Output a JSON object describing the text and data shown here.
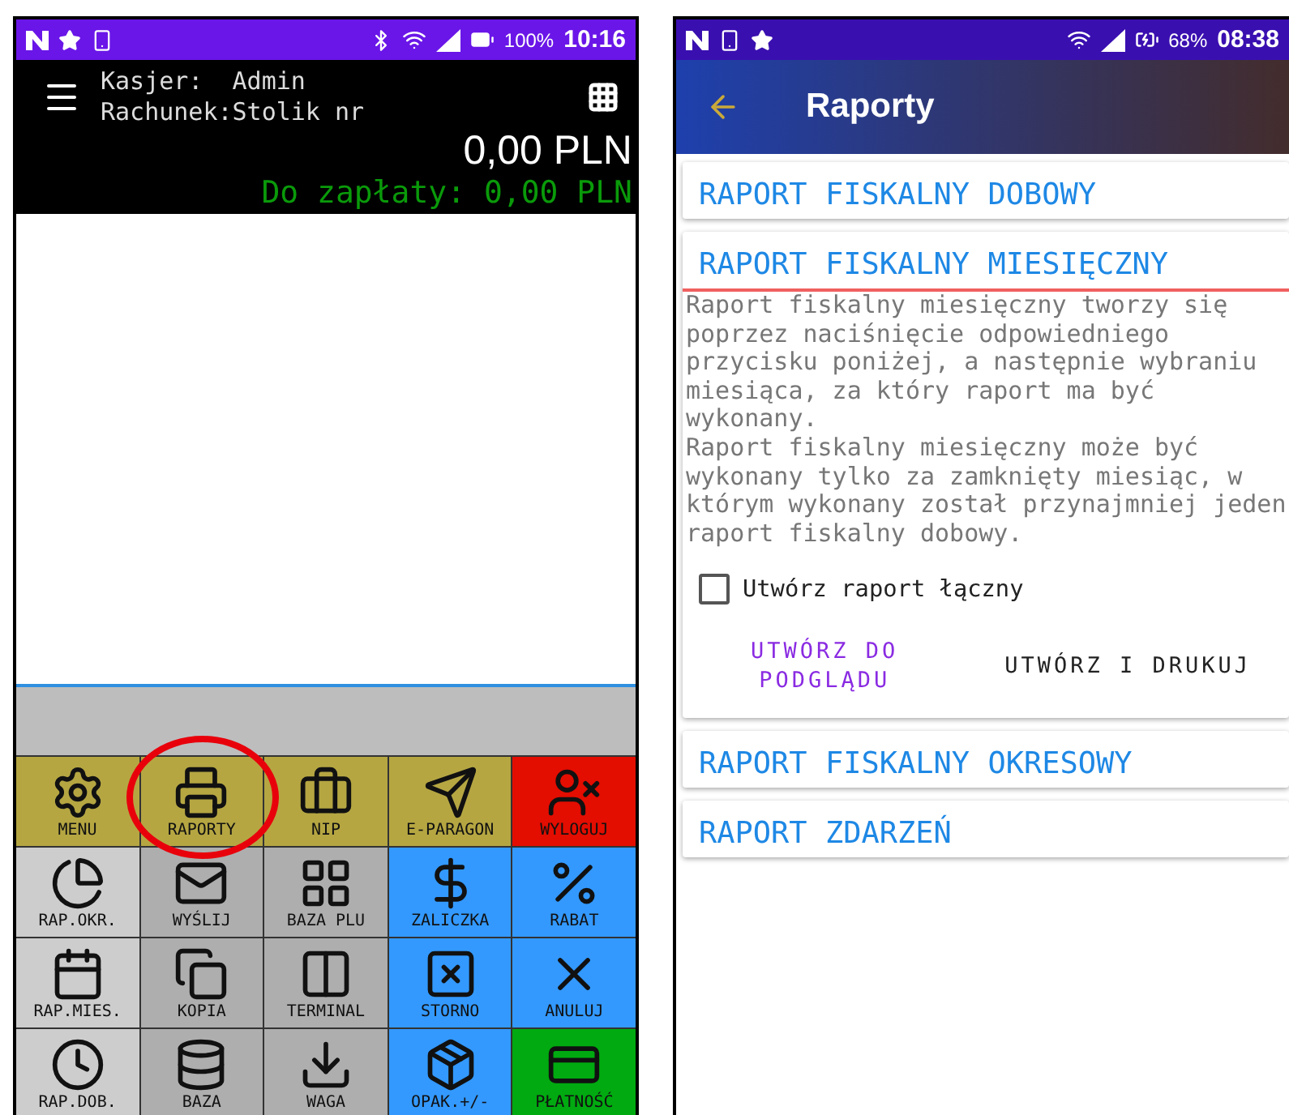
{
  "left_phone": {
    "status_bar": {
      "battery": "100%",
      "time": "10:16"
    },
    "header": {
      "cashier": "Kasjer:  Admin",
      "bill": "Rachunek:Stolik nr",
      "total": "0,00 PLN",
      "to_pay": "Do zapłaty: 0,00 PLN"
    },
    "tiles": [
      {
        "label": "MENU",
        "color": "#b5a642",
        "highlighted": false
      },
      {
        "label": "RAPORTY",
        "color": "#b5a642",
        "highlighted": true
      },
      {
        "label": "NIP",
        "color": "#b5a642",
        "highlighted": false
      },
      {
        "label": "E-PARAGON",
        "color": "#b5a642",
        "highlighted": false
      },
      {
        "label": "WYLOGUJ",
        "color": "#e30d00",
        "highlighted": false
      },
      {
        "label": "RAP.OKR.",
        "color": "#cdcdcd",
        "highlighted": false
      },
      {
        "label": "WYŚLIJ",
        "color": "#aeaeae",
        "highlighted": false
      },
      {
        "label": "BAZA PLU",
        "color": "#aeaeae",
        "highlighted": false
      },
      {
        "label": "ZALICZKA",
        "color": "#3399ff",
        "highlighted": false
      },
      {
        "label": "RABAT",
        "color": "#3399ff",
        "highlighted": false
      },
      {
        "label": "RAP.MIES.",
        "color": "#cdcdcd",
        "highlighted": false
      },
      {
        "label": "KOPIA",
        "color": "#aeaeae",
        "highlighted": false
      },
      {
        "label": "TERMINAL",
        "color": "#aeaeae",
        "highlighted": false
      },
      {
        "label": "STORNO",
        "color": "#3399ff",
        "highlighted": false
      },
      {
        "label": "ANULUJ",
        "color": "#3399ff",
        "highlighted": false
      },
      {
        "label": "RAP.DOB.",
        "color": "#cdcdcd",
        "highlighted": false
      },
      {
        "label": "BAZA",
        "color": "#aeaeae",
        "highlighted": false
      },
      {
        "label": "WAGA",
        "color": "#aeaeae",
        "highlighted": false
      },
      {
        "label": "OPAK.+/-",
        "color": "#3399ff",
        "highlighted": false
      },
      {
        "label": "PŁATNOŚĆ",
        "color": "#00aa10",
        "highlighted": false
      }
    ]
  },
  "right_phone": {
    "status_bar": {
      "battery": "68%",
      "time": "08:38"
    },
    "app_bar": {
      "title": "Raporty"
    },
    "reports": [
      {
        "title": "RAPORT FISKALNY DOBOWY",
        "expanded": false
      },
      {
        "title": "RAPORT FISKALNY MIESIĘCZNY",
        "expanded": true,
        "description": [
          "Raport fiskalny miesięczny tworzy się poprzez naciśnięcie odpowiedniego przycisku poniżej, a następnie wybraniu miesiąca, za który raport ma być wykonany.",
          "Raport fiskalny miesięczny może być wykonany tylko za zamknięty miesiąc, w którym wykonany został przynajmniej jeden raport fiskalny dobowy."
        ],
        "checkbox": {
          "label": "Utwórz raport łączny",
          "checked": false
        },
        "buttons": [
          "UTWÓRZ DO PODGLĄDU",
          "UTWÓRZ I DRUKUJ"
        ]
      },
      {
        "title": "RAPORT FISKALNY OKRESOWY",
        "expanded": false
      },
      {
        "title": "RAPORT ZDARZEŃ",
        "expanded": false
      }
    ]
  }
}
